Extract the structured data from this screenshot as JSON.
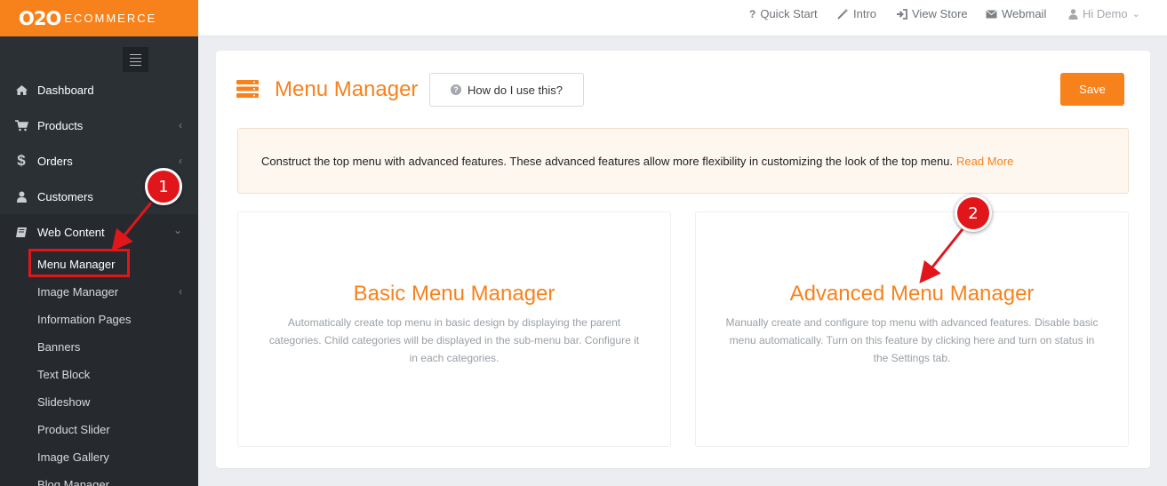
{
  "brand": {
    "logo_main": "O2O",
    "logo_sub": "ECOMMERCE",
    "accent": "#f7821b"
  },
  "topbar": {
    "quick_start": "Quick Start",
    "intro": "Intro",
    "view_store": "View Store",
    "webmail": "Webmail",
    "user": "Hi Demo"
  },
  "sidebar": {
    "items": [
      {
        "label": "Dashboard",
        "icon": "home-icon"
      },
      {
        "label": "Products",
        "icon": "cart-icon"
      },
      {
        "label": "Orders",
        "icon": "dollar-icon"
      },
      {
        "label": "Customers",
        "icon": "user-icon"
      },
      {
        "label": "Web Content",
        "icon": "book-icon"
      }
    ],
    "sub_items": [
      {
        "label": "Menu Manager"
      },
      {
        "label": "Image Manager"
      },
      {
        "label": "Information Pages"
      },
      {
        "label": "Banners"
      },
      {
        "label": "Text Block"
      },
      {
        "label": "Slideshow"
      },
      {
        "label": "Product Slider"
      },
      {
        "label": "Image Gallery"
      },
      {
        "label": "Blog Manager"
      }
    ]
  },
  "main": {
    "title": "Menu Manager",
    "help_label": "How do I use this?",
    "save_label": "Save",
    "info_text": "Construct the top menu with advanced features. These advanced features allow more flexibility in customizing the look of the top menu.",
    "read_more": "Read More",
    "cards": [
      {
        "title": "Basic Menu Manager",
        "desc": "Automatically create top menu in basic design by displaying the parent categories. Child categories will be displayed in the sub-menu bar. Configure it in each categories."
      },
      {
        "title": "Advanced Menu Manager",
        "desc": "Manually create and configure top menu with advanced features. Disable basic menu automatically. Turn on this feature by clicking here and turn on status in the Settings tab."
      }
    ]
  },
  "annotations": {
    "marker_1": "1",
    "marker_2": "2",
    "color": "#e0161b"
  }
}
